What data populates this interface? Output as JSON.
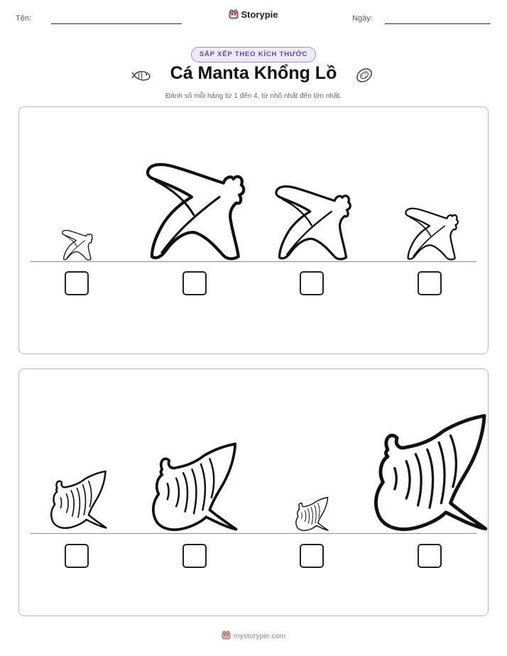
{
  "header": {
    "name_label": "Tên:",
    "date_label": "Ngày:",
    "brand": "Storypie"
  },
  "badge": "SẮP XẾP THEO KÍCH THƯỚC",
  "title": "Cá Manta Khổng Lồ",
  "instructions": "Đánh số mỗi hàng từ 1 đến 4, từ nhỏ nhất đến lớn nhất.",
  "rows": [
    {
      "items": [
        {
          "answer": ""
        },
        {
          "answer": ""
        },
        {
          "answer": ""
        },
        {
          "answer": ""
        }
      ]
    },
    {
      "items": [
        {
          "answer": ""
        },
        {
          "answer": ""
        },
        {
          "answer": ""
        },
        {
          "answer": ""
        }
      ]
    }
  ],
  "footer": "mystorypie.com"
}
